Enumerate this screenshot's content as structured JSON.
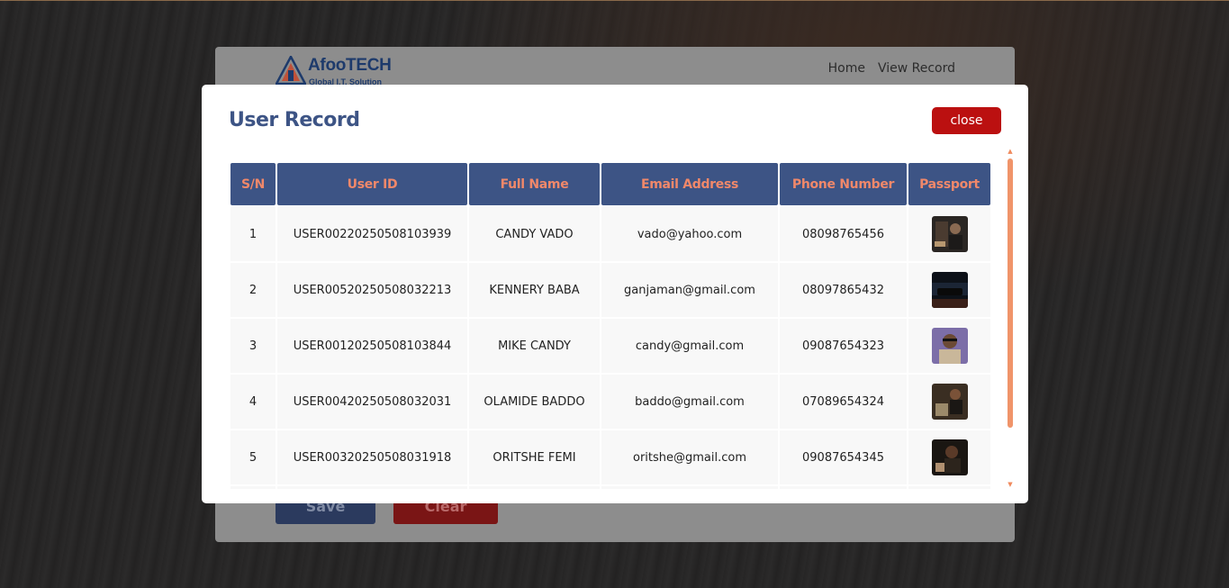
{
  "brand": {
    "title": "AfooTECH",
    "subtitle": "Global I.T. Solution"
  },
  "nav": {
    "home": "Home",
    "view_record": "View Record"
  },
  "form_buttons": {
    "save": "Save",
    "clear": "Clear"
  },
  "modal": {
    "title": "User Record",
    "close_label": "close",
    "columns": [
      "S/N",
      "User ID",
      "Full Name",
      "Email Address",
      "Phone Number",
      "Passport"
    ],
    "rows": [
      {
        "sn": "1",
        "user_id": "USER00220250508103939",
        "full_name": "CANDY VADO",
        "email": "vado@yahoo.com",
        "phone": "08098765456",
        "passport_icon": "passport-photo"
      },
      {
        "sn": "2",
        "user_id": "USER00520250508032213",
        "full_name": "KENNERY BABA",
        "email": "ganjaman@gmail.com",
        "phone": "08097865432",
        "passport_icon": "passport-photo"
      },
      {
        "sn": "3",
        "user_id": "USER00120250508103844",
        "full_name": "MIKE CANDY",
        "email": "candy@gmail.com",
        "phone": "09087654323",
        "passport_icon": "passport-photo"
      },
      {
        "sn": "4",
        "user_id": "USER00420250508032031",
        "full_name": "OLAMIDE BADDO",
        "email": "baddo@gmail.com",
        "phone": "07089654324",
        "passport_icon": "passport-photo"
      },
      {
        "sn": "5",
        "user_id": "USER00320250508031918",
        "full_name": "ORITSHE FEMI",
        "email": "oritshe@gmail.com",
        "phone": "09087654345",
        "passport_icon": "passport-photo"
      }
    ]
  },
  "colors": {
    "header_bg": "#3d5485",
    "header_text": "#f0886a",
    "close_button": "#bb1010",
    "scroll_thumb": "#f0946a"
  }
}
